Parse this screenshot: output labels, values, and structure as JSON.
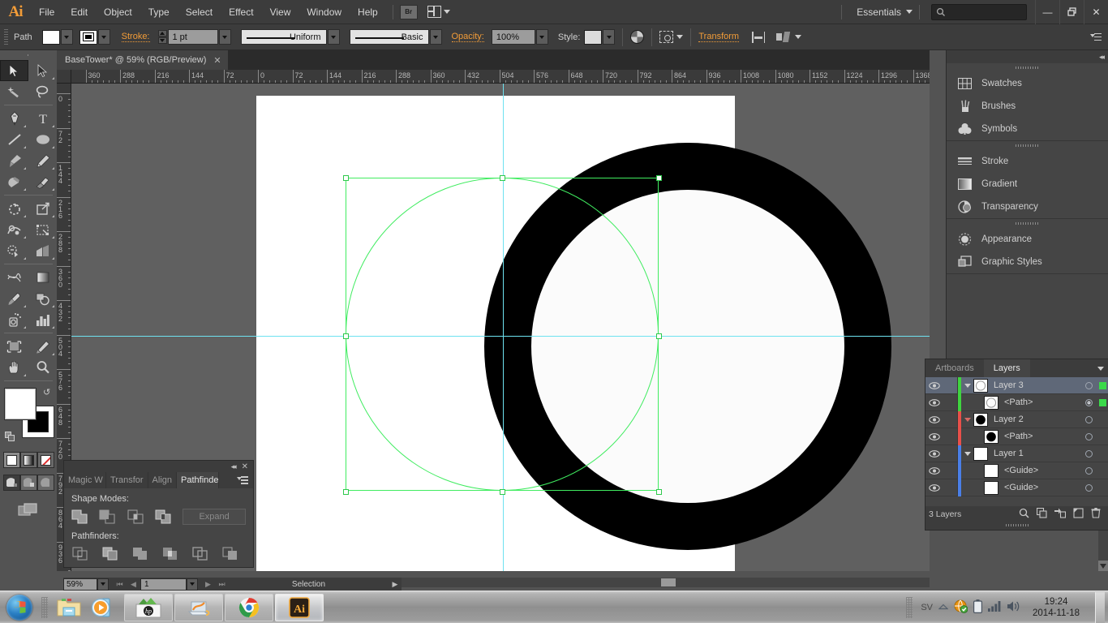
{
  "app": {
    "logo": "Ai",
    "menus": [
      "File",
      "Edit",
      "Object",
      "Type",
      "Select",
      "Effect",
      "View",
      "Window",
      "Help"
    ],
    "bridge_label": "Br",
    "workspace": "Essentials",
    "search_placeholder": "",
    "window_buttons": {
      "minimize": "—",
      "restore": "❐",
      "close": "✕"
    }
  },
  "control_bar": {
    "object_label": "Path",
    "fill_color": "#ffffff",
    "stroke_color": "#000000",
    "stroke_label": "Stroke:",
    "stroke_weight": "1 pt",
    "profile": "Uniform",
    "brush": "Basic",
    "opacity_label": "Opacity:",
    "opacity_value": "100%",
    "style_label": "Style:",
    "transform_label": "Transform",
    "icons": [
      "opacity-icon",
      "select-similar-icon",
      "align-icon",
      "distribute-icon"
    ]
  },
  "document": {
    "tab_title": "BaseTower* @ 59% (RGB/Preview)",
    "close_glyph": "✕"
  },
  "rulers": {
    "horizontal": [
      "360",
      "288",
      "216",
      "144",
      "72",
      "0",
      "72",
      "144",
      "216",
      "288",
      "360",
      "432",
      "504",
      "576",
      "648",
      "720",
      "792",
      "864",
      "936",
      "1008",
      "1080",
      "1152",
      "1224",
      "1296",
      "1368"
    ],
    "vertical": [
      "0",
      "72",
      "144",
      "216",
      "288",
      "360",
      "432",
      "504",
      "576",
      "648",
      "720",
      "792",
      "864",
      "936"
    ]
  },
  "toolbox": {
    "tools": [
      {
        "name": "selection-tool",
        "active": true
      },
      {
        "name": "direct-selection-tool",
        "active": false
      },
      {
        "name": "magic-wand-tool",
        "active": false
      },
      {
        "name": "lasso-tool",
        "active": false
      },
      {
        "name": "pen-tool",
        "active": false
      },
      {
        "name": "type-tool",
        "active": false
      },
      {
        "name": "line-segment-tool",
        "active": false
      },
      {
        "name": "ellipse-tool",
        "active": false
      },
      {
        "name": "paintbrush-tool",
        "active": false
      },
      {
        "name": "pencil-tool",
        "active": false
      },
      {
        "name": "blob-brush-tool",
        "active": false
      },
      {
        "name": "eraser-tool",
        "active": false
      },
      {
        "name": "rotate-tool",
        "active": false
      },
      {
        "name": "scale-tool",
        "active": false
      },
      {
        "name": "width-tool",
        "active": false
      },
      {
        "name": "free-transform-tool",
        "active": false
      },
      {
        "name": "shape-builder-tool",
        "active": false
      },
      {
        "name": "perspective-grid-tool",
        "active": false
      },
      {
        "name": "mesh-tool",
        "active": false
      },
      {
        "name": "gradient-tool",
        "active": false
      },
      {
        "name": "eyedropper-tool",
        "active": false
      },
      {
        "name": "blend-tool",
        "active": false
      },
      {
        "name": "symbol-sprayer-tool",
        "active": false
      },
      {
        "name": "column-graph-tool",
        "active": false
      },
      {
        "name": "artboard-tool",
        "active": false
      },
      {
        "name": "slice-tool",
        "active": false
      },
      {
        "name": "hand-tool",
        "active": false
      },
      {
        "name": "zoom-tool",
        "active": false
      }
    ],
    "fill_color": "#ffffff",
    "stroke_color": "#000000",
    "paint_modes": [
      "color-swatch",
      "gradient",
      "none"
    ],
    "screen_modes": [
      "normal-screen-mode",
      "full-screen-with-menu",
      "full-screen"
    ]
  },
  "pathfinder_panel": {
    "tabs": [
      "Magic W",
      "Transfor",
      "Align",
      "Pathfinder"
    ],
    "active_tab": "Pathfinder",
    "shape_modes_label": "Shape Modes:",
    "pathfinders_label": "Pathfinders:",
    "expand_label": "Expand",
    "shape_mode_buttons": [
      "unite",
      "minus-front",
      "intersect",
      "exclude"
    ],
    "pathfinder_buttons": [
      "divide",
      "trim",
      "merge",
      "crop",
      "outline",
      "minus-back"
    ],
    "collapse_glyph": "◂◂",
    "close_glyph": "✕"
  },
  "right_dock": {
    "collapse_glyph": "◂◂",
    "groups": [
      {
        "items": [
          {
            "label": "Swatches",
            "icon": "swatches-icon"
          },
          {
            "label": "Brushes",
            "icon": "brushes-icon"
          },
          {
            "label": "Symbols",
            "icon": "symbols-icon"
          }
        ]
      },
      {
        "items": [
          {
            "label": "Stroke",
            "icon": "stroke-icon"
          },
          {
            "label": "Gradient",
            "icon": "gradient-icon"
          },
          {
            "label": "Transparency",
            "icon": "transparency-icon"
          }
        ]
      },
      {
        "items": [
          {
            "label": "Appearance",
            "icon": "appearance-icon"
          },
          {
            "label": "Graphic Styles",
            "icon": "graphic-styles-icon"
          }
        ]
      }
    ]
  },
  "layers_panel": {
    "tabs": [
      "Artboards",
      "Layers"
    ],
    "active_tab": "Layers",
    "rows": [
      {
        "name": "Layer 3",
        "indent": 0,
        "color": "#3fd43f",
        "thumb": "ring-white",
        "selected": true,
        "target": "single",
        "has_selection_square": true,
        "expanded": true
      },
      {
        "name": "<Path>",
        "indent": 1,
        "color": "#3fd43f",
        "thumb": "ring-white",
        "selected": false,
        "target": "double",
        "has_selection_square": true,
        "expanded": null
      },
      {
        "name": "Layer 2",
        "indent": 0,
        "color": "#e8504a",
        "thumb": "dot-black",
        "selected": false,
        "target": "single",
        "has_selection_square": false,
        "expanded": true
      },
      {
        "name": "<Path>",
        "indent": 1,
        "color": "#e8504a",
        "thumb": "dot-black",
        "selected": false,
        "target": "single",
        "has_selection_square": false,
        "expanded": null
      },
      {
        "name": "Layer 1",
        "indent": 0,
        "color": "#4a7fe8",
        "thumb": "blank",
        "selected": false,
        "target": "single",
        "has_selection_square": false,
        "expanded": true
      },
      {
        "name": "<Guide>",
        "indent": 1,
        "color": "#4a7fe8",
        "thumb": "blank",
        "selected": false,
        "target": "single",
        "has_selection_square": false,
        "expanded": null
      },
      {
        "name": "<Guide>",
        "indent": 1,
        "color": "#4a7fe8",
        "thumb": "blank",
        "selected": false,
        "target": "single",
        "has_selection_square": false,
        "expanded": null
      }
    ],
    "footer_count": "3 Layers",
    "footer_icons": [
      "locate-object-icon",
      "make-clipping-mask-icon",
      "create-new-sublayer-icon",
      "create-new-layer-icon",
      "delete-selection-icon"
    ]
  },
  "status_bar": {
    "zoom": "59%",
    "page": "1",
    "status_text": "Selection"
  },
  "artwork": {
    "shape": "black-ring-with-white-inner-circle",
    "ring_color": "#000000",
    "inner_color": "#fbfbfb",
    "artboard_color": "#ffffff",
    "guide_color": "#6ee2f0",
    "selection_color": "#40ec60"
  },
  "taskbar": {
    "start": "start-orb",
    "quick_launch": [
      "file-explorer-icon",
      "media-player-icon"
    ],
    "tasks": [
      "hp-support-assistant",
      "photo-app",
      "google-chrome",
      "adobe-illustrator"
    ],
    "tray": {
      "language": "SV",
      "icons": [
        "show-hidden-icons",
        "network-icon",
        "battery-icon",
        "signal-icon",
        "volume-icon"
      ],
      "time": "19:24",
      "date": "2014-11-18"
    }
  }
}
